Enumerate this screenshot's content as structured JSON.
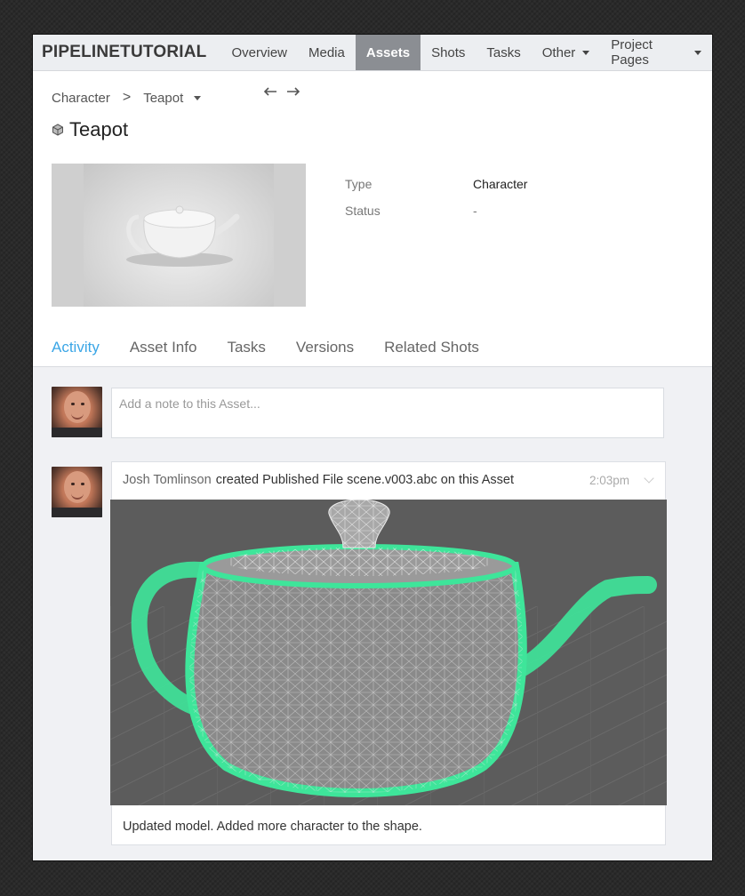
{
  "nav": {
    "brand": "PIPELINETUTORIAL",
    "items": [
      {
        "label": "Overview"
      },
      {
        "label": "Media"
      },
      {
        "label": "Assets",
        "active": true
      },
      {
        "label": "Shots"
      },
      {
        "label": "Tasks"
      },
      {
        "label": "Other",
        "dropdown": true
      },
      {
        "label": "Project Pages",
        "dropdown": true
      }
    ]
  },
  "breadcrumb": {
    "parent": "Character",
    "separator": ">",
    "current": "Teapot"
  },
  "header": {
    "title": "Teapot",
    "icon": "cube-icon"
  },
  "details": {
    "type_label": "Type",
    "type_value": "Character",
    "status_label": "Status",
    "status_value": "-"
  },
  "tabs": [
    {
      "label": "Activity",
      "active": true
    },
    {
      "label": "Asset Info"
    },
    {
      "label": "Tasks"
    },
    {
      "label": "Versions"
    },
    {
      "label": "Related Shots"
    }
  ],
  "note_input": {
    "placeholder": "Add a note to this Asset..."
  },
  "activity": {
    "user": "Josh Tomlinson",
    "action": "created Published File scene.v003.abc on this Asset",
    "time": "2:03pm",
    "caption": "Updated model. Added more character to the shape."
  },
  "colors": {
    "accent": "#3ba6e6",
    "nav_active": "#8b8e93",
    "wireframe": "#3ee59a"
  }
}
